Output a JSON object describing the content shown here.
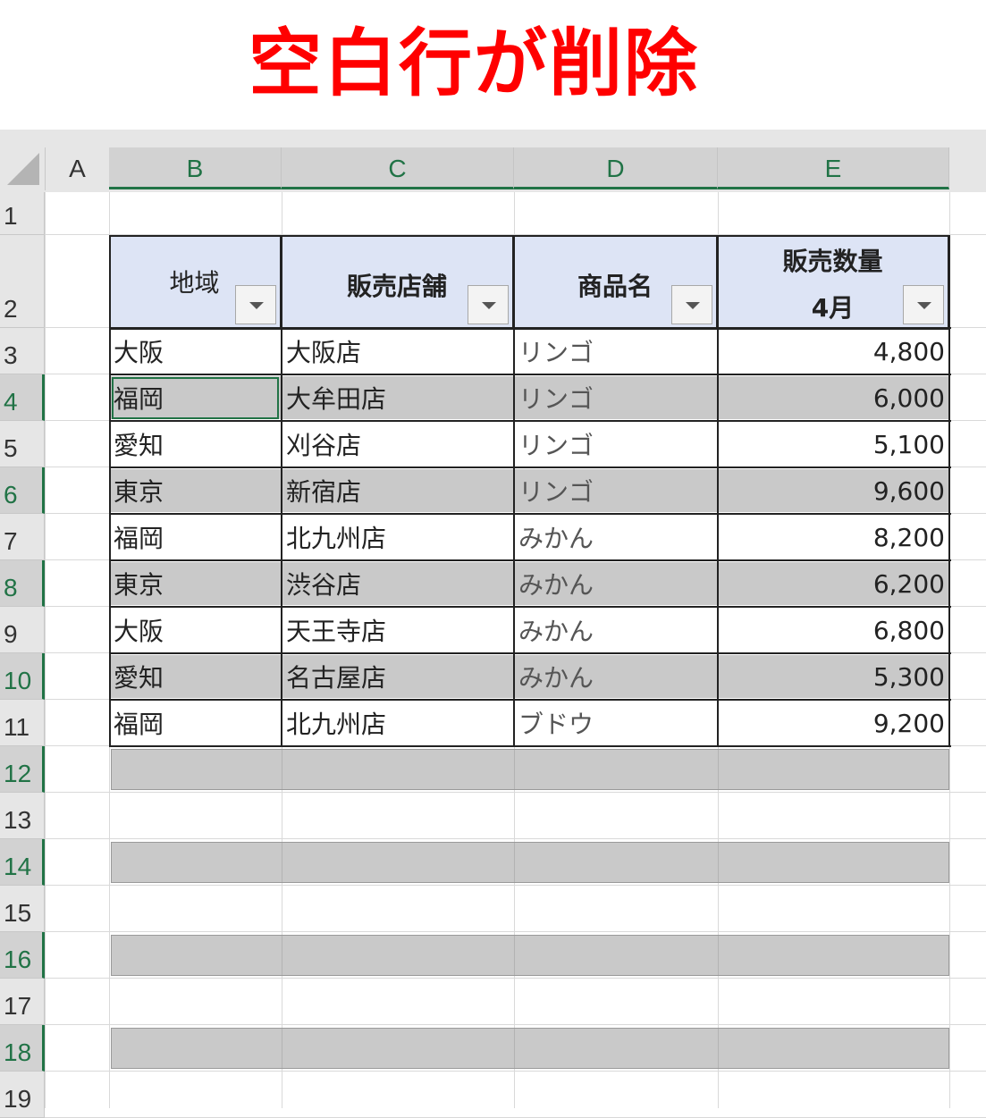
{
  "banner": {
    "title": "空白行が削除"
  },
  "sheet": {
    "columns": [
      "A",
      "B",
      "C",
      "D",
      "E"
    ],
    "selected_columns": [
      "B",
      "C",
      "D",
      "E"
    ],
    "row_numbers": [
      "1",
      "2",
      "3",
      "4",
      "5",
      "6",
      "7",
      "8",
      "9",
      "10",
      "11",
      "12",
      "13",
      "14",
      "15",
      "16",
      "17",
      "18",
      "19"
    ],
    "selected_rows": [
      "4",
      "6",
      "8",
      "10",
      "12",
      "14",
      "16",
      "18"
    ],
    "active_cell": "B4",
    "header": {
      "region": "地域",
      "store": "販売店舗",
      "product": "商品名",
      "sales_line1": "販売数量",
      "sales_line2": "4月"
    },
    "rows": [
      {
        "region": "大阪",
        "store": "大阪店",
        "product": "リンゴ",
        "qty": "4,800"
      },
      {
        "region": "福岡",
        "store": "大牟田店",
        "product": "リンゴ",
        "qty": "6,000"
      },
      {
        "region": "愛知",
        "store": "刈谷店",
        "product": "リンゴ",
        "qty": "5,100"
      },
      {
        "region": "東京",
        "store": "新宿店",
        "product": "リンゴ",
        "qty": "9,600"
      },
      {
        "region": "福岡",
        "store": "北九州店",
        "product": "みかん",
        "qty": "8,200"
      },
      {
        "region": "東京",
        "store": "渋谷店",
        "product": "みかん",
        "qty": "6,200"
      },
      {
        "region": "大阪",
        "store": "天王寺店",
        "product": "みかん",
        "qty": "6,800"
      },
      {
        "region": "愛知",
        "store": "名古屋店",
        "product": "みかん",
        "qty": "5,300"
      },
      {
        "region": "福岡",
        "store": "北九州店",
        "product": "ブドウ",
        "qty": "9,200"
      }
    ]
  },
  "colors": {
    "title": "#ff0000",
    "header_fill": "#dde4f5",
    "selection_fill": "#c9c9c9",
    "excel_green": "#217346"
  }
}
